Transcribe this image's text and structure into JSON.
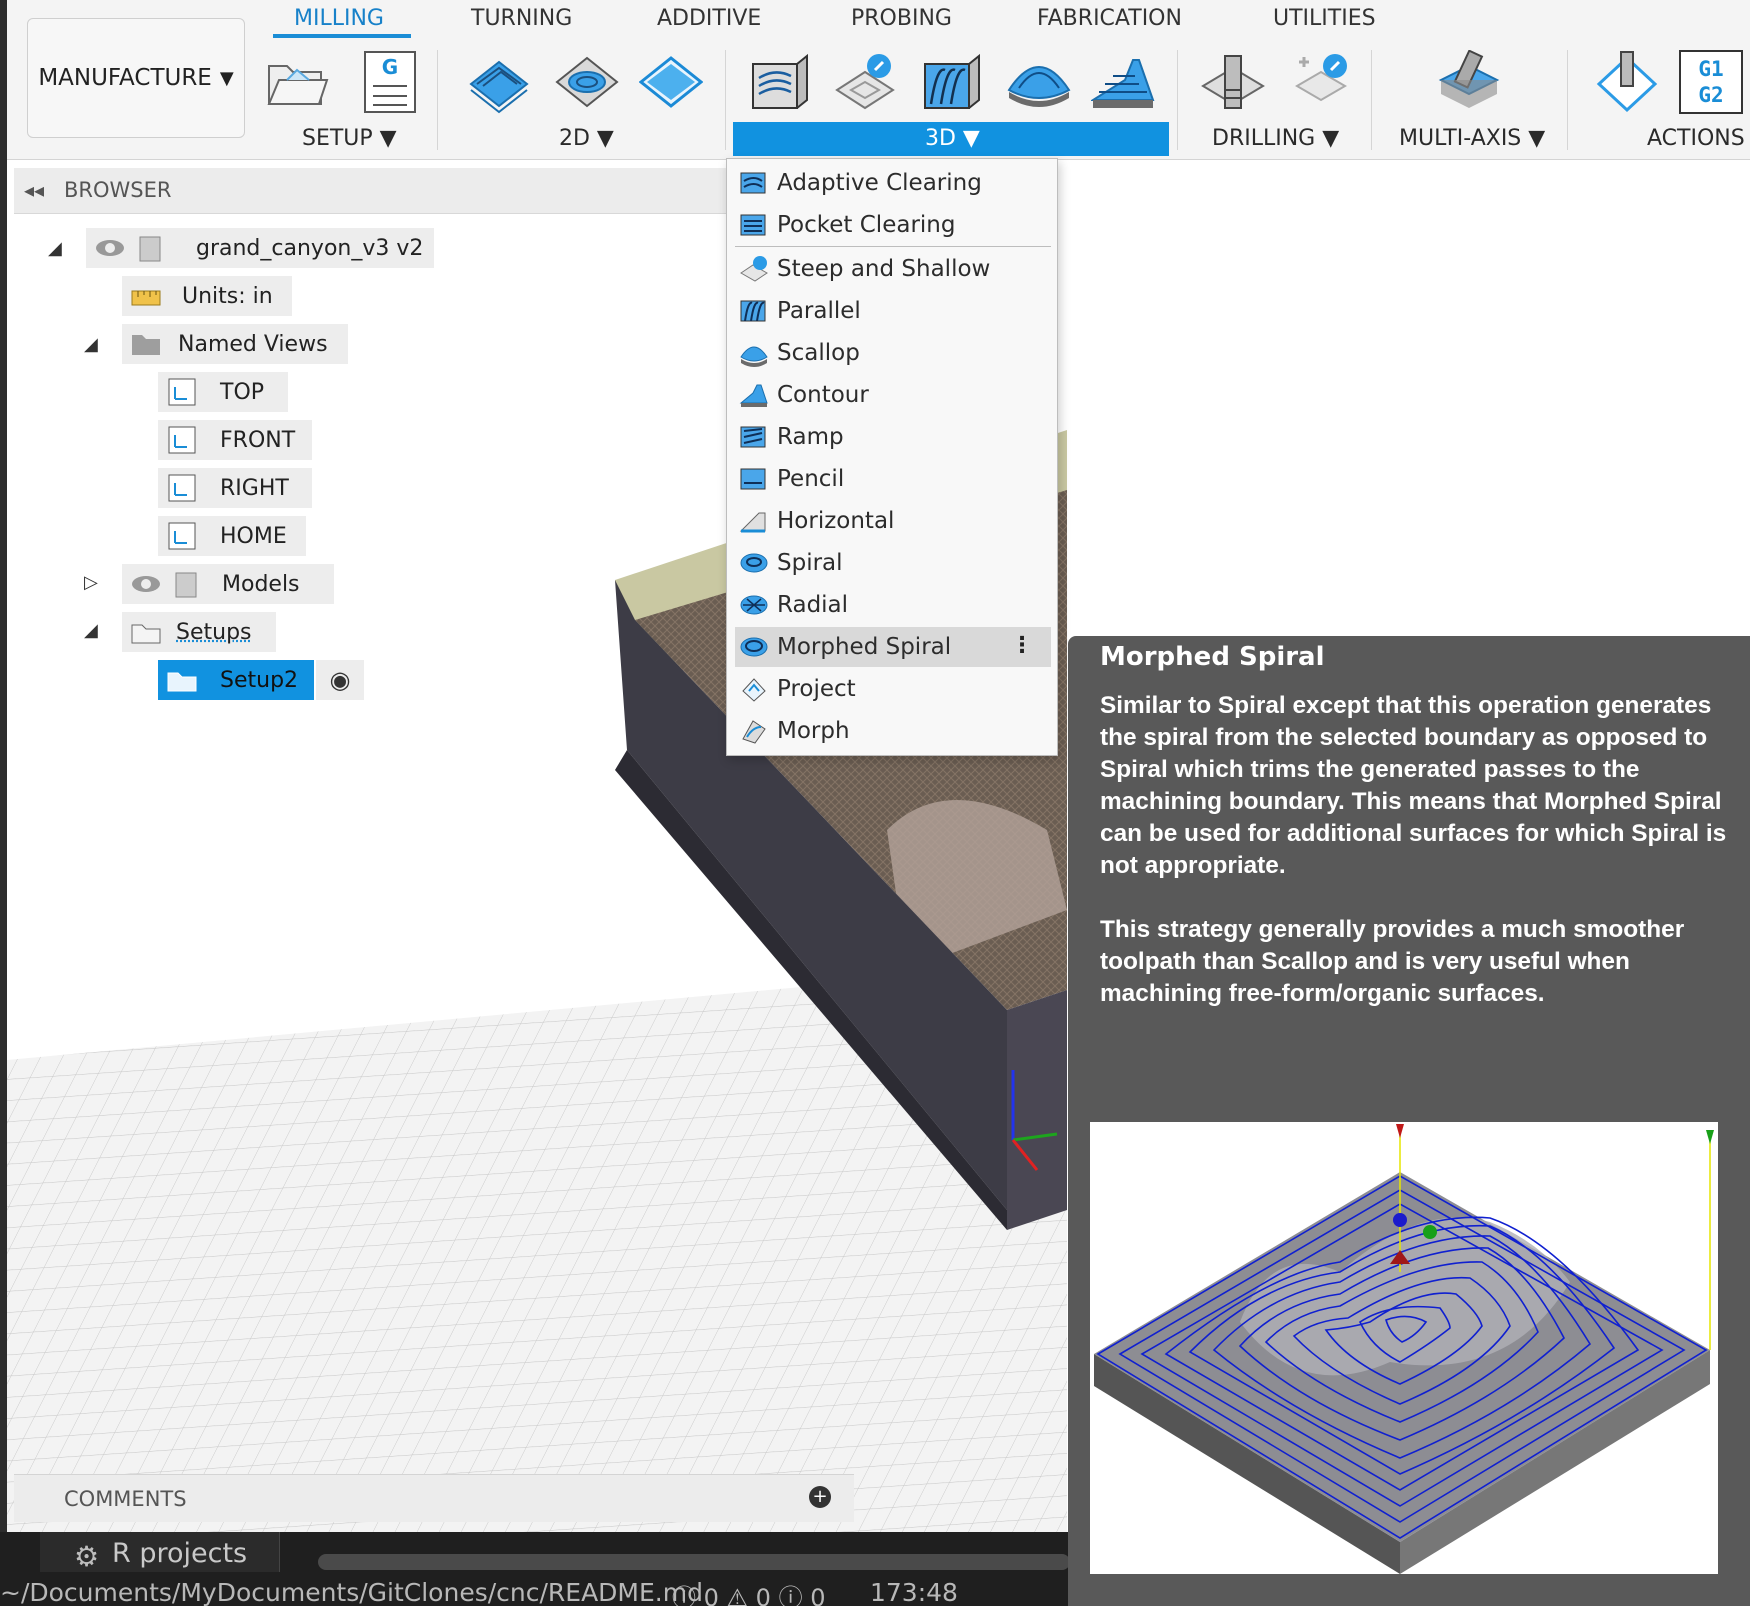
{
  "workspace": {
    "label": "MANUFACTURE"
  },
  "tabs": [
    "MILLING",
    "TURNING",
    "ADDITIVE",
    "PROBING",
    "FABRICATION",
    "UTILITIES"
  ],
  "groups": {
    "setup": "SETUP",
    "two_d": "2D",
    "three_d": "3D",
    "drilling": "DRILLING",
    "multi_axis": "MULTI-AXIS",
    "actions": "ACTIONS",
    "actions_icon_text": "G1\nG2",
    "setup_icon_text": "G"
  },
  "browser": {
    "title": "BROWSER",
    "root": "grand_canyon_v3 v2",
    "units": "Units: in",
    "named_views": "Named Views",
    "views": [
      "TOP",
      "FRONT",
      "RIGHT",
      "HOME"
    ],
    "models": "Models",
    "setups": "Setups",
    "setup_item": "Setup2"
  },
  "comments": {
    "title": "COMMENTS"
  },
  "menu": {
    "items": [
      "Adaptive Clearing",
      "Pocket Clearing",
      "Steep and Shallow",
      "Parallel",
      "Scallop",
      "Contour",
      "Ramp",
      "Pencil",
      "Horizontal",
      "Spiral",
      "Radial",
      "Morphed Spiral",
      "Project",
      "Morph"
    ],
    "highlighted": "Morphed Spiral"
  },
  "tooltip": {
    "title": "Morphed Spiral",
    "paragraph1": "Similar to Spiral except that this operation generates the spiral from the selected boundary as opposed to Spiral which trims the generated passes to the machining boundary. This means that Morphed Spiral can be used for additional surfaces for which Spiral is not appropriate.",
    "paragraph2": "This strategy generally provides a much smoother toolpath than Scallop and is very useful when machining free-form/organic surfaces."
  },
  "os": {
    "r_projects": "R projects",
    "path": "~/Documents/MyDocuments/GitClones/cnc/README.md",
    "problems": "ⓘ 0 ⚠ 0 ⓘ 0",
    "cursor": "173:48"
  },
  "colors": {
    "accent": "#1192e0",
    "tooltip_bg": "#595959",
    "toolpath": "#1020d0"
  },
  "icons": [
    "setup-folder-icon",
    "nc-program-icon",
    "2d-adaptive-icon",
    "2d-pocket-icon",
    "face-icon",
    "3d-adaptive-icon",
    "steep-shallow-icon",
    "parallel-icon",
    "scallop-icon",
    "contour-icon",
    "drill-icon",
    "probe-icon",
    "multi-axis-icon",
    "simulate-icon",
    "post-process-icon"
  ]
}
